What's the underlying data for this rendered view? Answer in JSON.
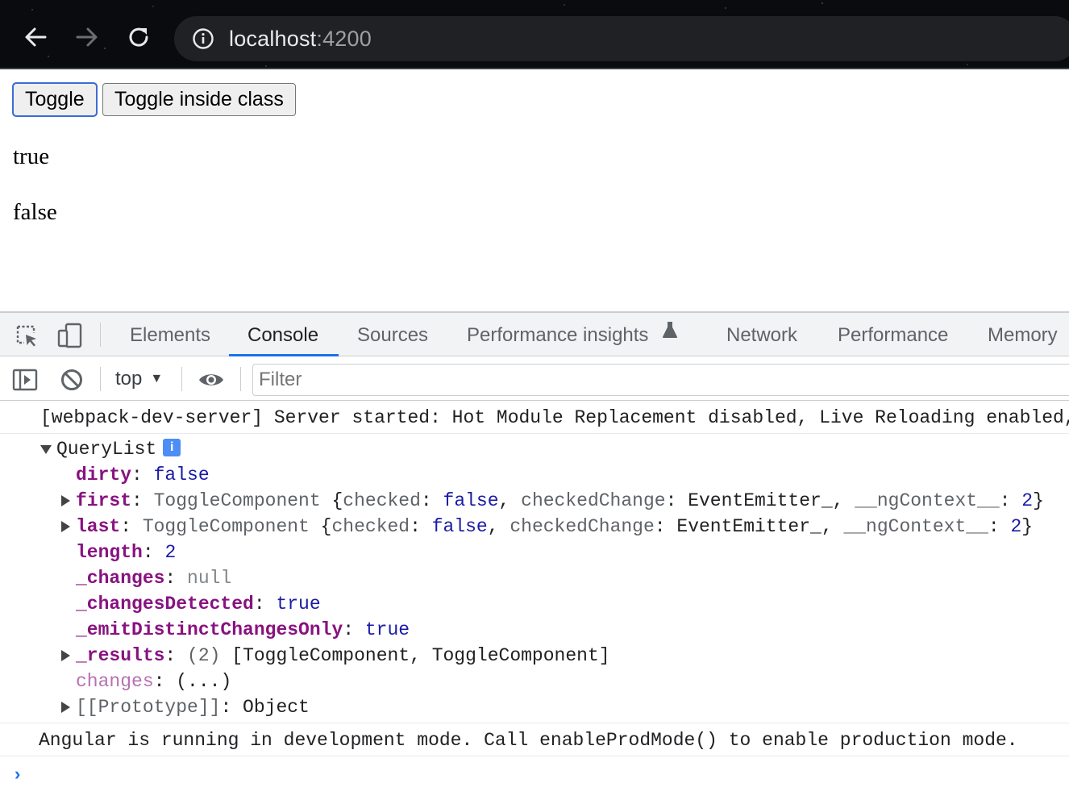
{
  "browser": {
    "url_host": "localhost",
    "url_port": ":4200",
    "icons": [
      "back-arrow-icon",
      "forward-arrow-icon",
      "reload-icon",
      "info-icon"
    ]
  },
  "page": {
    "buttons": [
      "Toggle",
      "Toggle inside class"
    ],
    "text_lines": [
      "true",
      "false"
    ]
  },
  "devtools": {
    "tabs": [
      "Elements",
      "Console",
      "Sources",
      "Performance insights",
      "Network",
      "Performance",
      "Memory"
    ],
    "active_tab": "Console",
    "context": "top",
    "filter_placeholder": "Filter",
    "accent_color": "#1a73e8"
  },
  "console": {
    "server_message": "[webpack-dev-server] Server started: Hot Module Replacement disabled, Live Reloading enabled, Progress disabled, Overlay enabled.",
    "object_name": "QueryList",
    "info_badge": "i",
    "dirty_key": "dirty",
    "dirty_val": "false",
    "first_key": "first",
    "first_class": "ToggleComponent",
    "last_key": "last",
    "last_class": "ToggleComponent",
    "checked_key": "checked",
    "checked_val": "false",
    "checked_change_key": "checkedChange",
    "checked_change_val": "EventEmitter_",
    "ng_context_key": "__ngContext__",
    "first_ng_context_val": "2",
    "last_ng_context_val": "2",
    "length_key": "length",
    "length_val": "2",
    "changes_key": "_changes",
    "changes_val": "null",
    "changes_detected_key": "_changesDetected",
    "changes_detected_val": "true",
    "emit_distinct_key": "_emitDistinctChangesOnly",
    "emit_distinct_val": "true",
    "results_key": "_results",
    "results_count": "(2)",
    "results_val": "[ToggleComponent, ToggleComponent]",
    "changes_getter_key": "changes",
    "changes_getter_val": "(...)",
    "prototype_key": "[[Prototype]]",
    "prototype_val": "Object",
    "angular_message": "Angular is running in development mode. Call enableProdMode() to enable production mode.",
    "prompt_symbol": "›"
  }
}
